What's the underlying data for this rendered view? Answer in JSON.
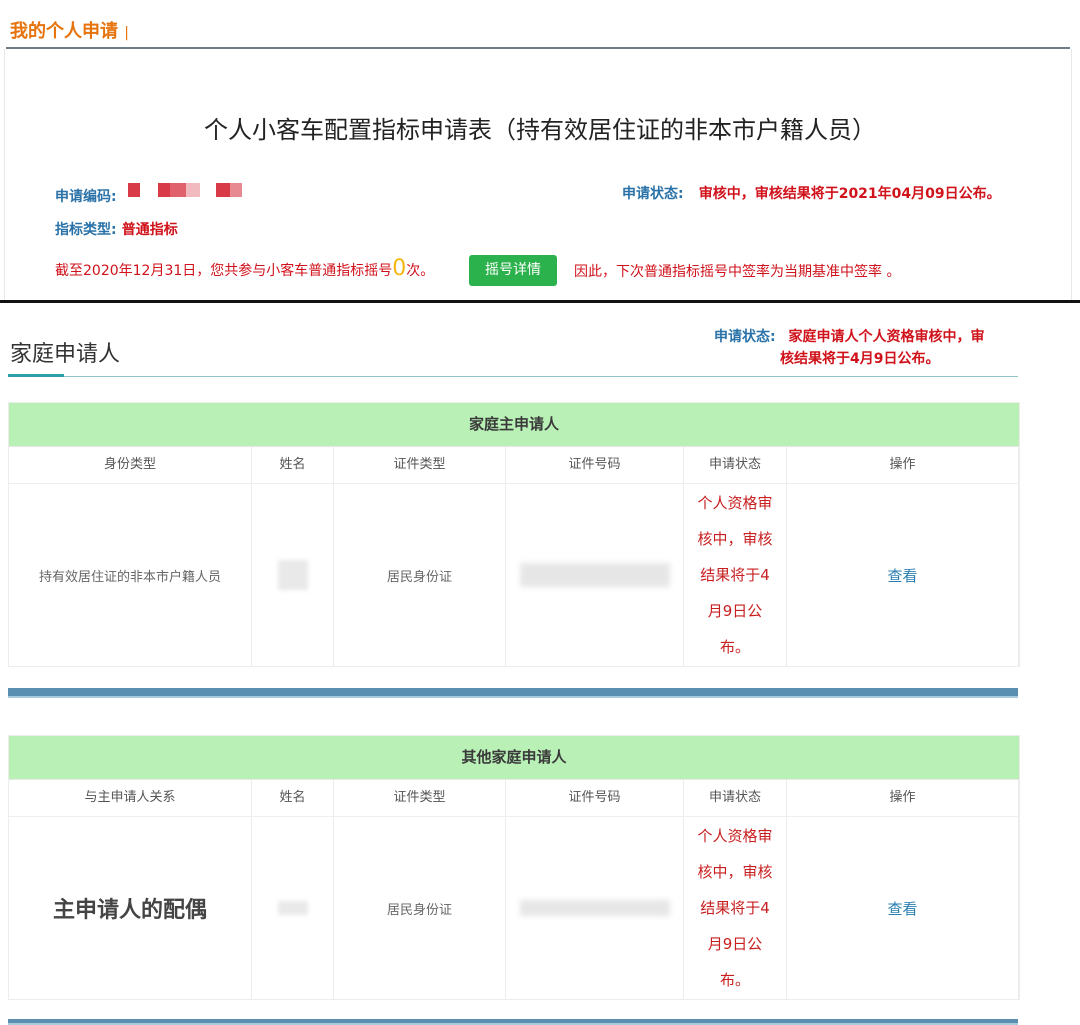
{
  "header": {
    "title": "我的个人申请",
    "cursor": "|"
  },
  "form": {
    "title": "个人小客车配置指标申请表（持有效居住证的非本市户籍人员）",
    "code_label": "申请编码:",
    "status_label": "申请状态:",
    "status_value": "审核中，审核结果将于2021年04月09日公布。",
    "type_label": "指标类型:",
    "type_value": "普通指标",
    "notice_prefix": "截至2020年12月31日，您共参与小客车普通指标摇号",
    "notice_count": "0",
    "notice_suffix": "次。",
    "detail_button": "摇号详情",
    "notice_tail": "因此，下次普通指标摇号中签率为当期基准中签率 。"
  },
  "family": {
    "section_title": "家庭申请人",
    "status_label": "申请状态:",
    "status_value_1": "家庭申请人个人资格审核中，审",
    "status_value_2": "核结果将于4月9日公布。",
    "main_table": {
      "title": "家庭主申请人",
      "columns": [
        "身份类型",
        "姓名",
        "证件类型",
        "证件号码",
        "申请状态",
        "操作"
      ],
      "row": {
        "identity": "持有效居住证的非本市户籍人员",
        "id_type": "居民身份证",
        "status_lines": [
          "个人资格审",
          "核中，审核",
          "结果将于4",
          "月9日公",
          "布。"
        ],
        "action": "查看"
      }
    },
    "other_table": {
      "title": "其他家庭申请人",
      "columns": [
        "与主申请人关系",
        "姓名",
        "证件类型",
        "证件号码",
        "申请状态",
        "操作"
      ],
      "row": {
        "relation": "主申请人的配偶",
        "id_type": "居民身份证",
        "status_lines": [
          "个人资格审",
          "核中，审核",
          "结果将于4",
          "月9日公",
          "布。"
        ],
        "action": "查看"
      }
    }
  },
  "colors": {
    "accent_orange": "#e6730b",
    "label_blue": "#2a72a8",
    "status_red": "#d0121b",
    "button_green": "#2bb24c",
    "table_header_green": "#b8f0b6"
  }
}
